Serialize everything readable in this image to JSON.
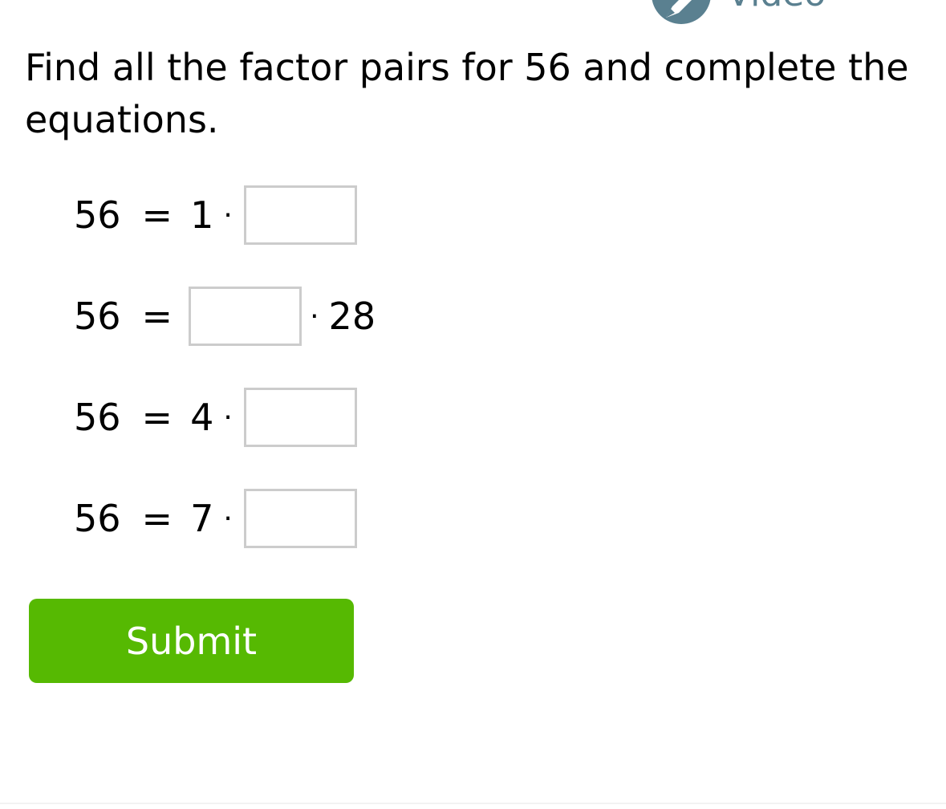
{
  "video": {
    "label": "Video",
    "icon": "pencil-icon",
    "color": "#5a8090"
  },
  "question": {
    "text": "Find all the factor pairs for 56 and complete the equations."
  },
  "equations": [
    {
      "lhs": "56",
      "equals": "=",
      "given": "1",
      "dot": "·",
      "answer": ""
    },
    {
      "lhs": "56",
      "equals": "=",
      "answer": "",
      "dot": "·",
      "given": "28"
    },
    {
      "lhs": "56",
      "equals": "=",
      "given": "4",
      "dot": "·",
      "answer": ""
    },
    {
      "lhs": "56",
      "equals": "=",
      "given": "7",
      "dot": "·",
      "answer": ""
    }
  ],
  "submit": {
    "label": "Submit",
    "color": "#56b902"
  }
}
